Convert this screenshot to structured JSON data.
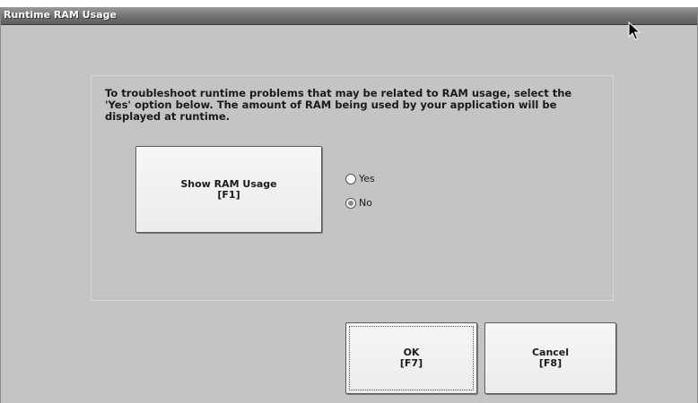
{
  "window": {
    "title": "Runtime RAM Usage"
  },
  "description": "To troubleshoot runtime problems that may be related to RAM usage, select the 'Yes' option below. The amount of RAM being used by your application will be displayed at runtime.",
  "show_ram_button": {
    "label": "Show RAM Usage",
    "key": "[F1]"
  },
  "options": {
    "yes": {
      "label": "Yes",
      "checked": false
    },
    "no": {
      "label": "No",
      "checked": true
    }
  },
  "ok_button": {
    "label": "OK",
    "key": "[F7]"
  },
  "cancel_button": {
    "label": "Cancel",
    "key": "[F8]"
  },
  "cursor_icon": "arrow-pointer-icon"
}
